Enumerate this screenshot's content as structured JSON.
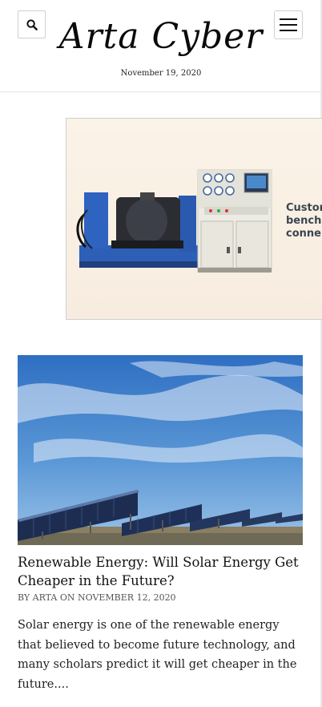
{
  "site": {
    "title": "Arta Cyber",
    "date": "November 19, 2020"
  },
  "header": {
    "search_icon": "search-icon",
    "menu_icon": "hamburger-menu-icon"
  },
  "ad": {
    "text_lines": [
      "Custon",
      "bench",
      "conne"
    ]
  },
  "post": {
    "title": "Renewable Energy: Will Solar Energy Get Cheaper in the Future?",
    "meta": "BY ARTA ON NOVEMBER 12, 2020",
    "excerpt": "Solar energy is one of the renewable energy that believed to become future technology, and many scholars predict it will get cheaper in the future...."
  }
}
